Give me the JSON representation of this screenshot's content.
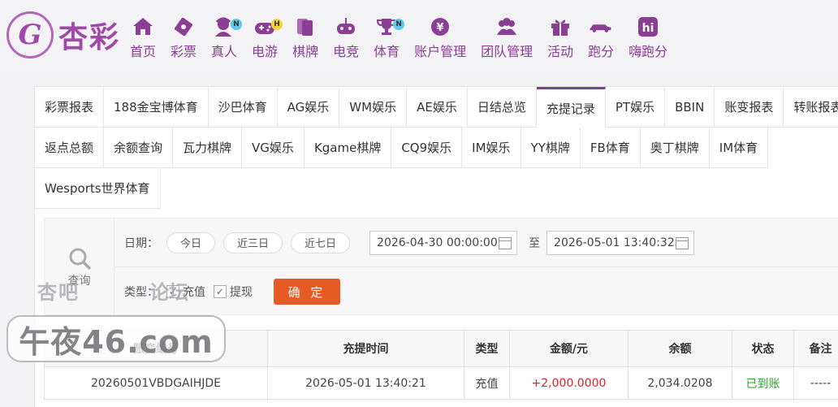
{
  "brand": {
    "name": "杏彩",
    "emblem_letter": "G"
  },
  "nav": [
    {
      "label": "首页",
      "icon": "home-icon",
      "badge": ""
    },
    {
      "label": "彩票",
      "icon": "lottery-ticket-icon",
      "badge": ""
    },
    {
      "label": "真人",
      "icon": "live-dealer-icon",
      "badge": "N"
    },
    {
      "label": "电游",
      "icon": "gamepad-icon",
      "badge": "H"
    },
    {
      "label": "棋牌",
      "icon": "cards-icon",
      "badge": ""
    },
    {
      "label": "电竞",
      "icon": "esports-controller-icon",
      "badge": ""
    },
    {
      "label": "体育",
      "icon": "trophy-icon",
      "badge": "N"
    },
    {
      "label": "账户管理",
      "icon": "account-icon",
      "badge": ""
    },
    {
      "label": "团队管理",
      "icon": "team-icon",
      "badge": ""
    },
    {
      "label": "活动",
      "icon": "gift-icon",
      "badge": ""
    },
    {
      "label": "跑分",
      "icon": "car-icon",
      "badge": ""
    },
    {
      "label": "嗨跑分",
      "icon": "hi-icon",
      "badge": ""
    }
  ],
  "badge_colors": {
    "N": "#5ec9e8",
    "H": "#f2d534"
  },
  "tabs_row1": [
    "彩票报表",
    "188金宝博体育",
    "沙巴体育",
    "AG娱乐",
    "WM娱乐",
    "AE娱乐",
    "日结总览",
    "充提记录",
    "PT娱乐",
    "BBIN",
    "账变报表",
    "转账报表"
  ],
  "tabs_row2": [
    "返点总额",
    "余额查询",
    "瓦力棋牌",
    "VG娱乐",
    "Kgame棋牌",
    "CQ9娱乐",
    "IM娱乐",
    "YY棋牌",
    "FB体育",
    "奥丁棋牌",
    "IM体育"
  ],
  "tabs_row3": [
    "Wesports世界体育"
  ],
  "active_tab": "充提记录",
  "filter": {
    "search_label": "查询",
    "date_label": "日期：",
    "quick_ranges": [
      "今日",
      "近三日",
      "近七日"
    ],
    "start_date": "2026-04-30 00:00:00",
    "to_label": "至",
    "end_date": "2026-05-01 13:40:32",
    "type_label": "类型：",
    "types": [
      {
        "label": "充值",
        "checked": true
      },
      {
        "label": "提现",
        "checked": true
      }
    ],
    "confirm_label": "确 定"
  },
  "table": {
    "headers": [
      "账变编号",
      "充提时间",
      "类型",
      "金额/元",
      "余额",
      "状态",
      "备注"
    ],
    "rows": [
      [
        "20260501VBDGAIHJDE",
        "2026-05-01 13:40:21",
        "充值",
        "+2,000.0000",
        "2,034.0208",
        "已到账",
        "-----"
      ]
    ]
  },
  "watermark": {
    "line1_left": "杏吧",
    "line1_right": "论坛",
    "main": "午夜46.com"
  },
  "colors": {
    "brand": "#8a3f94",
    "confirm": "#e55a25",
    "amount": "#e0202a",
    "status_ok": "#2aa12a"
  }
}
